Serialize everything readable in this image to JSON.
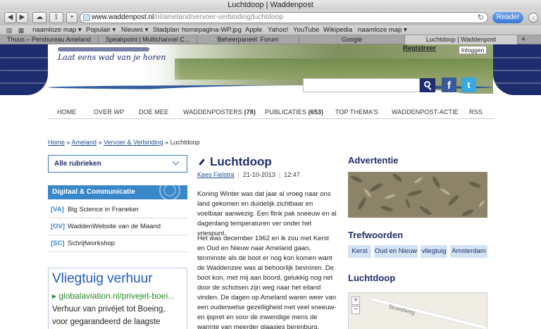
{
  "window": {
    "title": "Luchtdoop | Waddenpost"
  },
  "toolbar": {
    "back": "◀",
    "forward": "▶",
    "cloud": "☁",
    "share": "⇪",
    "new_tab": "+",
    "url_domain": "www.waddenpost.nl",
    "url_path": "/nl/ameland/vervoer-verbinding/luchtdoop",
    "reload": "↻",
    "reader": "Reader",
    "download": "↓"
  },
  "bookmarks": {
    "book_icon": "book-icon",
    "grid_icon": "grid-icon",
    "items": [
      "naamloze map ▾",
      "Populair ▾",
      "Nieuws ▾",
      "Stadplan",
      "homepagina-WP.jpg",
      "Apple",
      "Yahoo!",
      "YouTube",
      "Wikipedia",
      "naamloze map ▾"
    ]
  },
  "tabs": {
    "items": [
      "Thuus – Persbureau Ameland",
      "Speakpoint | Multichannel C...",
      "Beheerpaneel: Forum",
      "Google",
      "Luchtdoop | Waddenpost"
    ],
    "plus": "+"
  },
  "header": {
    "tagline": "Laat eens wad van je horen",
    "registreer": "Registreer",
    "inloggen": "Inloggen",
    "facebook": "f",
    "twitter": "t"
  },
  "nav": [
    {
      "label": "HOME",
      "count": ""
    },
    {
      "label": "OVER WP",
      "count": ""
    },
    {
      "label": "DOE MEE",
      "count": ""
    },
    {
      "label": "WADDENPOSTERS ",
      "count": "(78)"
    },
    {
      "label": "PUBLICATIES ",
      "count": "(653)"
    },
    {
      "label": "TOP THEMA'S",
      "count": ""
    },
    {
      "label": "WADDENPOST-ACTIE",
      "count": ""
    },
    {
      "label": "RSS",
      "count": ""
    }
  ],
  "breadcrumb": {
    "home": "Home",
    "sep": " » ",
    "ameland": "Ameland",
    "vervoer": "Vervoer & Verbinding",
    "current": "Luchtdoop"
  },
  "left": {
    "select": "Alle rubrieken",
    "category": "Digitaal & Communicatie",
    "items": [
      {
        "code": "[VA]",
        "text": "Big Science in Franeker"
      },
      {
        "code": "[OV]",
        "text": "WaddenWebsite van de Maand"
      },
      {
        "code": "[SC]",
        "text": "Schrijfworkshop"
      }
    ],
    "ad": {
      "title": "Vliegtuig verhuur",
      "url": "▸ globalaviation.nl/privejet-boei...",
      "line1": "Verhuur van privéjet tot Boeing,",
      "line2": "voor gegarandeerd de laagste"
    }
  },
  "article": {
    "title": "Luchtdoop",
    "author": "Kees Fielstra",
    "date": "21-10-2013",
    "time": "12:47",
    "sep": "|",
    "p1": "Koning Winter was dat jaar al vroeg naar ons land gekomen en duidelijk zichtbaar en voelbaar aanwezig. Een flink pak sneeuw en al dagenlang temperaturen ver onder het vriespunt.",
    "p2": "Het was december 1962 en ik zou met Kerst en Oud en Nieuw naar Ameland gaan, tenminste als de boot er nog kon komen want de Waddenzee was al behoorlijk bevroren. De boot kon, met mij aan boord, gelukkig nog net door de schotsen zijn weg naar het eiland vinden. De dagen op Ameland waren weer van een ouderwetse gezelligheid met veel sneeuw- en ijspret en voor de inwendige mens de warmte van meerder glaasjes berenburg."
  },
  "right": {
    "advert": "Advertentie",
    "trefwoorden": "Trefwoorden",
    "tags": [
      "Kerst",
      "Oud en Nieuw",
      "vliegtuig",
      "Amsterdam"
    ],
    "map_title": "Luchtdoop",
    "zoom_in": "+",
    "zoom_out": "−",
    "street": "Strandweg"
  },
  "colors": {
    "navy": "#1d2d6e",
    "blue": "#3887c9",
    "link": "#1d4c92"
  }
}
